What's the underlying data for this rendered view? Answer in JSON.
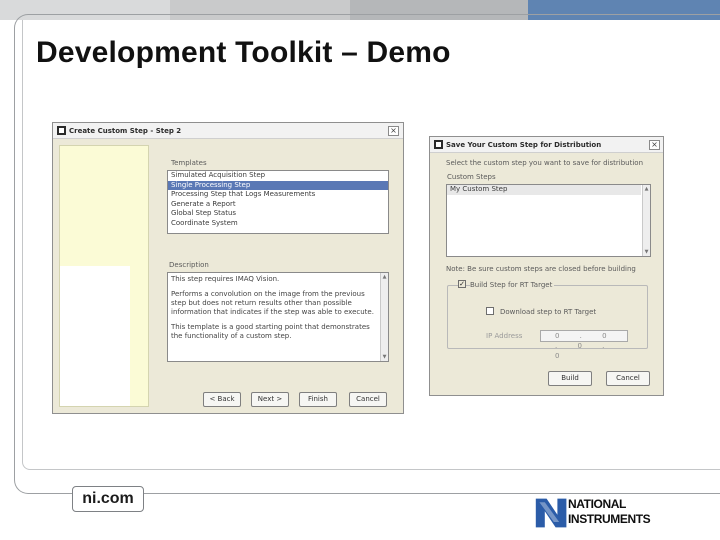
{
  "slide": {
    "title": "Development Toolkit – Demo",
    "footer_link": "ni.com",
    "logo_line1": "NATIONAL",
    "logo_line2": "INSTRUMENTS",
    "accent_color": "#5f84b2"
  },
  "dialog1": {
    "title": "Create Custom Step - Step 2",
    "templates_label": "Templates",
    "templates": [
      "Simulated Acquisition Step",
      "Single Processing Step",
      "Processing Step that Logs Measurements",
      "Generate a Report",
      "Global Step Status",
      "Coordinate System"
    ],
    "selected_index": 1,
    "description_label": "Description",
    "description_paragraphs": [
      "This step requires IMAQ Vision.",
      "Performs a convolution on the image from the previous step but does not return results other than possible information that indicates if the step was able to execute.",
      "This template is a good starting point that demonstrates the functionality of a custom step."
    ],
    "buttons": {
      "back": "< Back",
      "next": "Next >",
      "finish": "Finish",
      "cancel": "Cancel"
    }
  },
  "dialog2": {
    "title": "Save Your Custom Step for Distribution",
    "instruction": "Select the custom step you want to save for distribution",
    "custom_steps_label": "Custom Steps",
    "custom_steps": [
      "My Custom Step"
    ],
    "note": "Note: Be sure custom steps are closed before building",
    "build_rt_label": "Build Step for RT Target",
    "build_rt_checked": true,
    "download_label": "Download step to RT Target",
    "download_checked": false,
    "ip_label": "IP Address",
    "ip_value": "0 . 0 . 0 . 0",
    "buttons": {
      "build": "Build",
      "cancel": "Cancel"
    }
  }
}
